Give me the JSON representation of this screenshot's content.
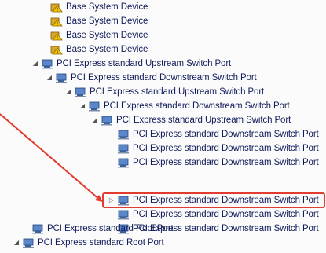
{
  "device_tree": {
    "rows": [
      {
        "label": "Base System Device",
        "toggle": "",
        "icon": "warning-device-icon"
      },
      {
        "label": "Base System Device",
        "toggle": "",
        "icon": "warning-device-icon"
      },
      {
        "label": "Base System Device",
        "toggle": "",
        "icon": "warning-device-icon"
      },
      {
        "label": "Base System Device",
        "toggle": "",
        "icon": "warning-device-icon"
      },
      {
        "label": "PCI Express standard Upstream Switch Port",
        "toggle": "◢",
        "icon": "pci-device-icon"
      },
      {
        "label": "PCI Express standard Downstream Switch Port",
        "toggle": "◢",
        "icon": "pci-device-icon"
      },
      {
        "label": "PCI Express standard Upstream Switch Port",
        "toggle": "◢",
        "icon": "pci-device-icon"
      },
      {
        "label": "PCI Express standard Downstream Switch Port",
        "toggle": "◢",
        "icon": "pci-device-icon"
      },
      {
        "label": "PCI Express standard Upstream Switch Port",
        "toggle": "◢",
        "icon": "pci-device-icon"
      },
      {
        "label": "PCI Express standard Downstream Switch Port",
        "toggle": "",
        "icon": "pci-device-icon"
      },
      {
        "label": "PCI Express standard Downstream Switch Port",
        "toggle": "",
        "icon": "pci-device-icon"
      },
      {
        "label": "PCI Express standard Downstream Switch Port",
        "toggle": "",
        "icon": "pci-device-icon"
      },
      {
        "label": "PCI Express standard Downstream Switch Port",
        "toggle": "▷",
        "icon": "pci-device-icon"
      },
      {
        "label": "PCI Express standard Downstream Switch Port",
        "toggle": "",
        "icon": "pci-device-icon"
      },
      {
        "label": "PCI Express standard Downstream Switch Port",
        "toggle": "",
        "icon": "pci-device-icon"
      },
      {
        "label": "PCI Express standard Root Port",
        "toggle": "",
        "icon": "pci-device-icon"
      },
      {
        "label": "PCI Express standard Root Port",
        "toggle": "◢",
        "icon": "pci-device-icon"
      }
    ]
  },
  "colors": {
    "highlight": "#e23b2f",
    "text": "#111c5a"
  }
}
